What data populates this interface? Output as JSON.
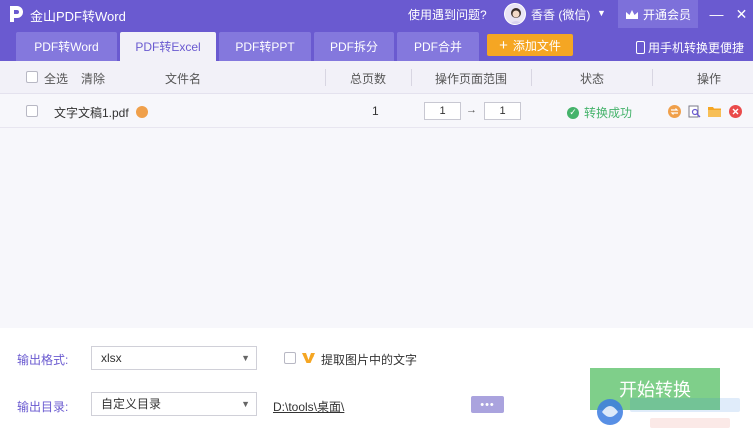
{
  "app": {
    "title": "金山PDF转Word",
    "help_link": "使用遇到问题?",
    "username": "香香 (微信)",
    "vip_label": "开通会员"
  },
  "tabs": [
    {
      "label": "PDF转Word",
      "active": false
    },
    {
      "label": "PDF转Excel",
      "active": true
    },
    {
      "label": "PDF转PPT",
      "active": false
    },
    {
      "label": "PDF拆分",
      "active": false
    },
    {
      "label": "PDF合并",
      "active": false
    }
  ],
  "toolbar": {
    "add_file_label": "添加文件",
    "phone_link": "用手机转换更便捷"
  },
  "table": {
    "select_all": "全选",
    "clear": "清除",
    "columns": {
      "filename": "文件名",
      "total_pages": "总页数",
      "page_range": "操作页面范围",
      "status": "状态",
      "actions": "操作"
    },
    "rows": [
      {
        "filename": "文字文稿1.pdf",
        "total_pages": "1",
        "range_from": "1",
        "range_to": "1",
        "range_arrow": "→",
        "status": "转换成功"
      }
    ]
  },
  "output": {
    "format_label": "输出格式:",
    "format_value": "xlsx",
    "extract_text_label": "提取图片中的文字",
    "dir_label": "输出目录:",
    "dir_value": "自定义目录",
    "path": "D:\\tools\\桌面\\",
    "browse_label": "•••",
    "start_label": "开始转换"
  },
  "colors": {
    "brand": "#6a5ad0",
    "accent": "#f5a623",
    "success": "#45b36b",
    "start_button": "#7fcf8a"
  },
  "icons": [
    "app-logo-icon",
    "crown-icon",
    "minimize-icon",
    "close-icon",
    "plus-icon",
    "phone-icon",
    "convert-icon",
    "preview-icon",
    "folder-icon",
    "delete-icon",
    "check-icon",
    "vip-icon",
    "chevron-down-icon"
  ]
}
